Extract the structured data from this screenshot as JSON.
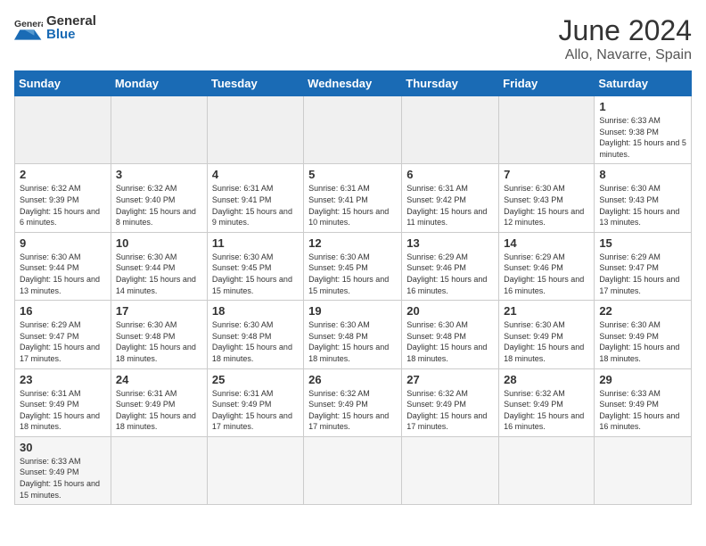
{
  "header": {
    "title": "June 2024",
    "subtitle": "Allo, Navarre, Spain",
    "logo_general": "General",
    "logo_blue": "Blue"
  },
  "weekdays": [
    "Sunday",
    "Monday",
    "Tuesday",
    "Wednesday",
    "Thursday",
    "Friday",
    "Saturday"
  ],
  "weeks": [
    [
      {
        "day": "",
        "info": ""
      },
      {
        "day": "",
        "info": ""
      },
      {
        "day": "",
        "info": ""
      },
      {
        "day": "",
        "info": ""
      },
      {
        "day": "",
        "info": ""
      },
      {
        "day": "",
        "info": ""
      },
      {
        "day": "1",
        "info": "Sunrise: 6:33 AM\nSunset: 9:38 PM\nDaylight: 15 hours and 5 minutes."
      }
    ],
    [
      {
        "day": "2",
        "info": "Sunrise: 6:32 AM\nSunset: 9:39 PM\nDaylight: 15 hours and 6 minutes."
      },
      {
        "day": "3",
        "info": "Sunrise: 6:32 AM\nSunset: 9:40 PM\nDaylight: 15 hours and 8 minutes."
      },
      {
        "day": "4",
        "info": "Sunrise: 6:31 AM\nSunset: 9:41 PM\nDaylight: 15 hours and 9 minutes."
      },
      {
        "day": "5",
        "info": "Sunrise: 6:31 AM\nSunset: 9:41 PM\nDaylight: 15 hours and 10 minutes."
      },
      {
        "day": "6",
        "info": "Sunrise: 6:31 AM\nSunset: 9:42 PM\nDaylight: 15 hours and 11 minutes."
      },
      {
        "day": "7",
        "info": "Sunrise: 6:30 AM\nSunset: 9:43 PM\nDaylight: 15 hours and 12 minutes."
      },
      {
        "day": "8",
        "info": "Sunrise: 6:30 AM\nSunset: 9:43 PM\nDaylight: 15 hours and 13 minutes."
      }
    ],
    [
      {
        "day": "9",
        "info": "Sunrise: 6:30 AM\nSunset: 9:44 PM\nDaylight: 15 hours and 13 minutes."
      },
      {
        "day": "10",
        "info": "Sunrise: 6:30 AM\nSunset: 9:44 PM\nDaylight: 15 hours and 14 minutes."
      },
      {
        "day": "11",
        "info": "Sunrise: 6:30 AM\nSunset: 9:45 PM\nDaylight: 15 hours and 15 minutes."
      },
      {
        "day": "12",
        "info": "Sunrise: 6:30 AM\nSunset: 9:45 PM\nDaylight: 15 hours and 15 minutes."
      },
      {
        "day": "13",
        "info": "Sunrise: 6:29 AM\nSunset: 9:46 PM\nDaylight: 15 hours and 16 minutes."
      },
      {
        "day": "14",
        "info": "Sunrise: 6:29 AM\nSunset: 9:46 PM\nDaylight: 15 hours and 16 minutes."
      },
      {
        "day": "15",
        "info": "Sunrise: 6:29 AM\nSunset: 9:47 PM\nDaylight: 15 hours and 17 minutes."
      }
    ],
    [
      {
        "day": "16",
        "info": "Sunrise: 6:29 AM\nSunset: 9:47 PM\nDaylight: 15 hours and 17 minutes."
      },
      {
        "day": "17",
        "info": "Sunrise: 6:30 AM\nSunset: 9:48 PM\nDaylight: 15 hours and 18 minutes."
      },
      {
        "day": "18",
        "info": "Sunrise: 6:30 AM\nSunset: 9:48 PM\nDaylight: 15 hours and 18 minutes."
      },
      {
        "day": "19",
        "info": "Sunrise: 6:30 AM\nSunset: 9:48 PM\nDaylight: 15 hours and 18 minutes."
      },
      {
        "day": "20",
        "info": "Sunrise: 6:30 AM\nSunset: 9:48 PM\nDaylight: 15 hours and 18 minutes."
      },
      {
        "day": "21",
        "info": "Sunrise: 6:30 AM\nSunset: 9:49 PM\nDaylight: 15 hours and 18 minutes."
      },
      {
        "day": "22",
        "info": "Sunrise: 6:30 AM\nSunset: 9:49 PM\nDaylight: 15 hours and 18 minutes."
      }
    ],
    [
      {
        "day": "23",
        "info": "Sunrise: 6:31 AM\nSunset: 9:49 PM\nDaylight: 15 hours and 18 minutes."
      },
      {
        "day": "24",
        "info": "Sunrise: 6:31 AM\nSunset: 9:49 PM\nDaylight: 15 hours and 18 minutes."
      },
      {
        "day": "25",
        "info": "Sunrise: 6:31 AM\nSunset: 9:49 PM\nDaylight: 15 hours and 17 minutes."
      },
      {
        "day": "26",
        "info": "Sunrise: 6:32 AM\nSunset: 9:49 PM\nDaylight: 15 hours and 17 minutes."
      },
      {
        "day": "27",
        "info": "Sunrise: 6:32 AM\nSunset: 9:49 PM\nDaylight: 15 hours and 17 minutes."
      },
      {
        "day": "28",
        "info": "Sunrise: 6:32 AM\nSunset: 9:49 PM\nDaylight: 15 hours and 16 minutes."
      },
      {
        "day": "29",
        "info": "Sunrise: 6:33 AM\nSunset: 9:49 PM\nDaylight: 15 hours and 16 minutes."
      }
    ],
    [
      {
        "day": "30",
        "info": "Sunrise: 6:33 AM\nSunset: 9:49 PM\nDaylight: 15 hours and 15 minutes."
      },
      {
        "day": "",
        "info": ""
      },
      {
        "day": "",
        "info": ""
      },
      {
        "day": "",
        "info": ""
      },
      {
        "day": "",
        "info": ""
      },
      {
        "day": "",
        "info": ""
      },
      {
        "day": "",
        "info": ""
      }
    ]
  ]
}
